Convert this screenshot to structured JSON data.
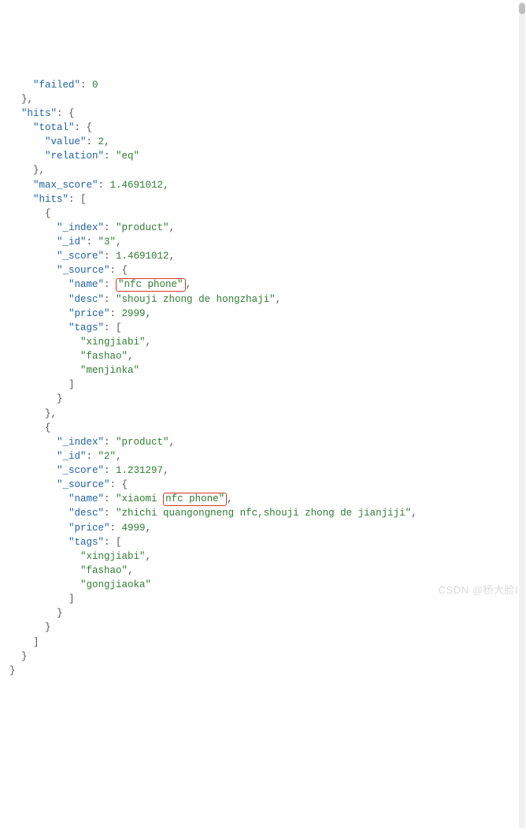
{
  "line01_key": "\"failed\"",
  "line01_val": "0",
  "line03_key": "\"hits\"",
  "line04_key": "\"total\"",
  "line05_key": "\"value\"",
  "line05_val": "2",
  "line06_key": "\"relation\"",
  "line06_val": "\"eq\"",
  "line08_key": "\"max_score\"",
  "line08_val": "1.4691012",
  "line09_key": "\"hits\"",
  "line11_key": "\"_index\"",
  "line11_val": "\"product\"",
  "line12_key": "\"_id\"",
  "line12_val": "\"3\"",
  "line13_key": "\"_score\"",
  "line13_val": "1.4691012",
  "line14_key": "\"_source\"",
  "line15_key": "\"name\"",
  "line15_val": "\"nfc phone\"",
  "line16_key": "\"desc\"",
  "line16_val": "\"shouji zhong de hongzhaji\"",
  "line17_key": "\"price\"",
  "line17_val": "2999",
  "line18_key": "\"tags\"",
  "line19_val": "\"xingjiabi\"",
  "line20_val": "\"fashao\"",
  "line21_val": "\"menjinka\"",
  "line25_key": "\"_index\"",
  "line25_val": "\"product\"",
  "line26_key": "\"_id\"",
  "line26_val": "\"2\"",
  "line27_key": "\"_score\"",
  "line27_val": "1.231297",
  "line28_key": "\"_source\"",
  "line29_key": "\"name\"",
  "line29_pre": "\"xiaomi ",
  "line29_hl": "nfc phone\"",
  "line30_key": "\"desc\"",
  "line30_val": "\"zhichi quangongneng nfc,shouji zhong de jianjiji\"",
  "line31_key": "\"price\"",
  "line31_val": "4999",
  "line32_key": "\"tags\"",
  "line33_val": "\"xingjiabi\"",
  "line34_val": "\"fashao\"",
  "line35_val": "\"gongjiaoka\"",
  "watermark": "CSDN @杨大脸I"
}
